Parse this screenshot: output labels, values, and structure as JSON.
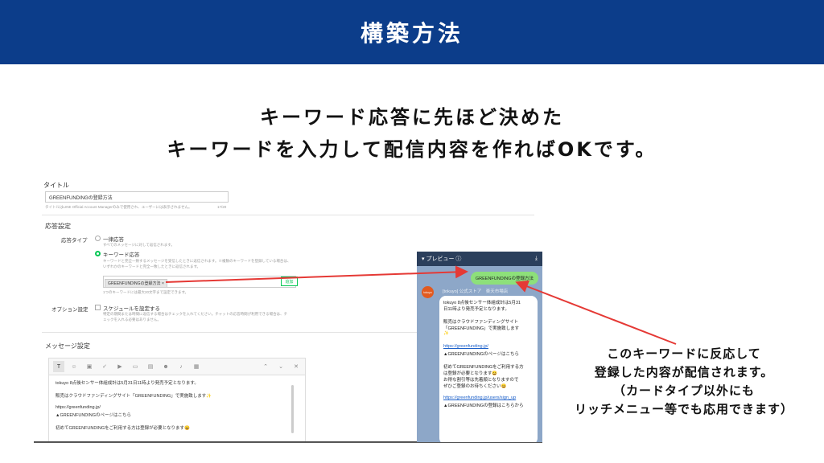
{
  "header": {
    "title": "構築方法"
  },
  "lead": {
    "line1": "キーワード応答に先ほど決めた",
    "line2": "キーワードを入力して配信内容を作ればOKです。"
  },
  "form": {
    "title_label": "タイトル",
    "title_value": "GREENFUNDINGの登録方法",
    "title_hint": "タイトルはLINE Official Account Managerのみで使用され、ユーザーには表示されません。",
    "title_count": "17/20",
    "response_label": "応答設定",
    "response_type_label": "応答タイプ",
    "option_general": "一律応答",
    "option_general_desc": "すべてのメッセージに対して返信されます。",
    "option_keyword": "キーワード応答",
    "option_keyword_desc1": "キーワードと完全一致するメッセージを受信したときに返信されます。※複数のキーワードを登録している場合は、",
    "option_keyword_desc2": "いずれかのキーワードと完全一致したときに返信されます。",
    "keyword_tag": "GREENFUNDINGの登録方法",
    "add_button": "追加",
    "keyword_hint": "1つのキーワードには最大20文字まで設定できます。",
    "option_setting_label": "オプション設定",
    "schedule_label": "スケジュールを設定する",
    "schedule_desc1": "特定の期間または時間に返信する場合はチェックを入れてください。チャットの応答時間が利用できる場合は、チ",
    "schedule_desc2": "ェックを入れる必要はありません。",
    "message_label": "メッセージ設定",
    "message_lines": [
      "tokuyo 8点後センサー体組成計は5月31日11時より発売予定となります。",
      "",
      "販売はクラウドファンディングサイト「GREENFUNDING」で実施致します✨",
      "",
      "https://greenfunding.jp/",
      "▲GREENFUNDINGのページはこちら",
      "",
      "初めてGREENFUNDINGをご利用する方は登録が必要となります😀"
    ]
  },
  "preview": {
    "bar_label": "▾ プレビュー ⓘ",
    "sent": "GREENFUNDINGの登録方法",
    "avatar": "tokuyo",
    "sender": "[tokuyo] 公式ストア　楽天市場店",
    "bubble_lines": [
      "tokuyo 8点後センサー体組成計は5月31",
      "日11時より発売予定となります。",
      "",
      "販売はクラウドファンディングサイト",
      "「GREENFUNDING」で実施致します",
      "✨",
      "",
      "https://greenfunding.jp/",
      "▲GREENFUNDINGのページはこちら",
      "",
      "初めてGREENFUNDINGをご利用する方",
      "は登録が必要となります😀",
      "お得な割引等は先着順となりますので",
      "ぜひご登録のお待ちください😀",
      "",
      "https://greenfunding.jp/users/sign_up",
      "▲GREENFUNDINGの登録はこちらから"
    ]
  },
  "caption": {
    "line1": "このキーワードに反応して",
    "line2": "登録した内容が配信されます。",
    "line3": "（カードタイプ以外にも",
    "line4": "リッチメニュー等でも応用できます）"
  },
  "colors": {
    "header": "#0c3d8a",
    "arrow": "#e53935",
    "accent_green": "#06c755"
  }
}
